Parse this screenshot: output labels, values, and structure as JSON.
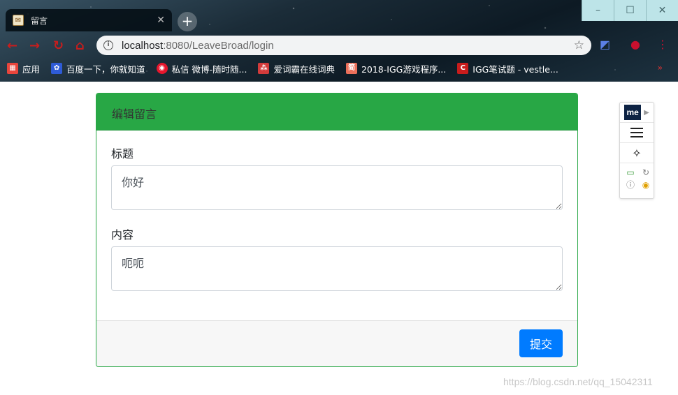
{
  "browser": {
    "tab_title": "留言",
    "url_host": "localhost",
    "url_path": ":8080/LeaveBroad/login",
    "bookmarks": [
      {
        "label": "应用",
        "icon": "apps-grid-icon",
        "color": "#e8453c"
      },
      {
        "label": "百度一下，你就知道",
        "icon": "baidu-paw-icon",
        "color": "#2e5bd6"
      },
      {
        "label": "私信 微博-随时随...",
        "icon": "weibo-icon",
        "color": "#e6162d"
      },
      {
        "label": "爱词霸在线词典",
        "icon": "iciba-icon",
        "color": "#d23b3b"
      },
      {
        "label": "2018-IGG游戏程序...",
        "icon": "jianshu-icon",
        "color": "#ea6f5a"
      },
      {
        "label": "IGG笔试题 - vestle...",
        "icon": "csdn-icon",
        "color": "#c91c1c"
      }
    ],
    "window_controls": [
      "–",
      "☐",
      "✕"
    ]
  },
  "form": {
    "header": "编辑留言",
    "title_label": "标题",
    "title_value": "你好",
    "content_label": "内容",
    "content_value": "呃呃",
    "submit_label": "提交"
  },
  "widget": {
    "logo": "me"
  },
  "watermark": "https://blog.csdn.net/qq_15042311",
  "colors": {
    "header_green": "#28a745",
    "submit_blue": "#007bff"
  }
}
